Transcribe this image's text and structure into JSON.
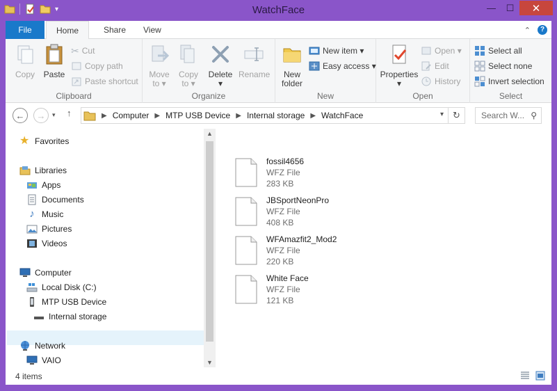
{
  "window": {
    "title": "WatchFace",
    "controls": {
      "minimize": "—",
      "maximize": "☐",
      "close": "✕"
    }
  },
  "ribbon_tabs": {
    "file": "File",
    "home": "Home",
    "share": "Share",
    "view": "View"
  },
  "ribbon": {
    "clipboard": {
      "label": "Clipboard",
      "copy": "Copy",
      "paste": "Paste",
      "cut": "Cut",
      "copy_path": "Copy path",
      "paste_shortcut": "Paste shortcut"
    },
    "organize": {
      "label": "Organize",
      "move_to": [
        "Move",
        "to ▾"
      ],
      "copy_to": [
        "Copy",
        "to ▾"
      ],
      "delete": [
        "Delete",
        "▾"
      ],
      "rename": "Rename"
    },
    "new": {
      "label": "New",
      "new_folder": [
        "New",
        "folder"
      ],
      "new_item": "New item ▾",
      "easy_access": "Easy access ▾"
    },
    "open": {
      "label": "Open",
      "properties": [
        "Properties",
        "▾"
      ],
      "open": "Open ▾",
      "edit": "Edit",
      "history": "History"
    },
    "select": {
      "label": "Select",
      "select_all": "Select all",
      "select_none": "Select none",
      "invert_selection": "Invert selection"
    }
  },
  "address": {
    "crumbs": [
      "Computer",
      "MTP USB Device",
      "Internal storage",
      "WatchFace"
    ],
    "search_placeholder": "Search W..."
  },
  "nav_pane": {
    "favorites": "Favorites",
    "libraries": "Libraries",
    "apps": "Apps",
    "documents": "Documents",
    "music": "Music",
    "pictures": "Pictures",
    "videos": "Videos",
    "computer": "Computer",
    "local_disk": "Local Disk (C:)",
    "mtp_device": "MTP USB Device",
    "internal_storage": "Internal storage",
    "network": "Network",
    "vaio": "VAIO"
  },
  "files": [
    {
      "name": "fossil4656",
      "type": "WFZ File",
      "size": "283 KB"
    },
    {
      "name": "JBSportNeonPro",
      "type": "WFZ File",
      "size": "408 KB"
    },
    {
      "name": "WFAmazfit2_Mod2",
      "type": "WFZ File",
      "size": "220 KB"
    },
    {
      "name": "White Face",
      "type": "WFZ File",
      "size": "121 KB"
    }
  ],
  "status": {
    "count": "4 items"
  },
  "colors": {
    "frame": "#8a55c9",
    "file_tab": "#1979ca",
    "selection": "#e5f3fb",
    "close": "#c7463d"
  }
}
